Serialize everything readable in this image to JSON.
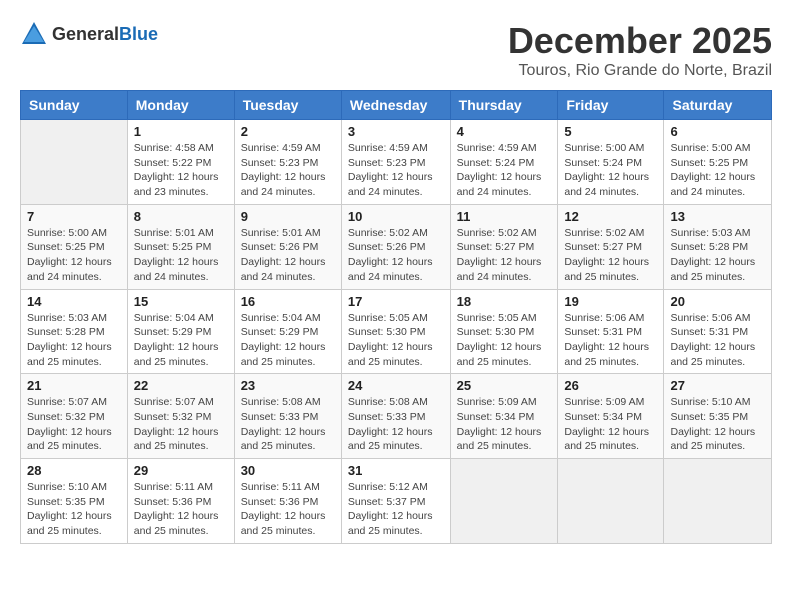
{
  "logo": {
    "general": "General",
    "blue": "Blue"
  },
  "title": "December 2025",
  "subtitle": "Touros, Rio Grande do Norte, Brazil",
  "days_header": [
    "Sunday",
    "Monday",
    "Tuesday",
    "Wednesday",
    "Thursday",
    "Friday",
    "Saturday"
  ],
  "weeks": [
    [
      {
        "day": "",
        "info": ""
      },
      {
        "day": "1",
        "info": "Sunrise: 4:58 AM\nSunset: 5:22 PM\nDaylight: 12 hours\nand 23 minutes."
      },
      {
        "day": "2",
        "info": "Sunrise: 4:59 AM\nSunset: 5:23 PM\nDaylight: 12 hours\nand 24 minutes."
      },
      {
        "day": "3",
        "info": "Sunrise: 4:59 AM\nSunset: 5:23 PM\nDaylight: 12 hours\nand 24 minutes."
      },
      {
        "day": "4",
        "info": "Sunrise: 4:59 AM\nSunset: 5:24 PM\nDaylight: 12 hours\nand 24 minutes."
      },
      {
        "day": "5",
        "info": "Sunrise: 5:00 AM\nSunset: 5:24 PM\nDaylight: 12 hours\nand 24 minutes."
      },
      {
        "day": "6",
        "info": "Sunrise: 5:00 AM\nSunset: 5:25 PM\nDaylight: 12 hours\nand 24 minutes."
      }
    ],
    [
      {
        "day": "7",
        "info": "Sunrise: 5:00 AM\nSunset: 5:25 PM\nDaylight: 12 hours\nand 24 minutes."
      },
      {
        "day": "8",
        "info": "Sunrise: 5:01 AM\nSunset: 5:25 PM\nDaylight: 12 hours\nand 24 minutes."
      },
      {
        "day": "9",
        "info": "Sunrise: 5:01 AM\nSunset: 5:26 PM\nDaylight: 12 hours\nand 24 minutes."
      },
      {
        "day": "10",
        "info": "Sunrise: 5:02 AM\nSunset: 5:26 PM\nDaylight: 12 hours\nand 24 minutes."
      },
      {
        "day": "11",
        "info": "Sunrise: 5:02 AM\nSunset: 5:27 PM\nDaylight: 12 hours\nand 24 minutes."
      },
      {
        "day": "12",
        "info": "Sunrise: 5:02 AM\nSunset: 5:27 PM\nDaylight: 12 hours\nand 25 minutes."
      },
      {
        "day": "13",
        "info": "Sunrise: 5:03 AM\nSunset: 5:28 PM\nDaylight: 12 hours\nand 25 minutes."
      }
    ],
    [
      {
        "day": "14",
        "info": "Sunrise: 5:03 AM\nSunset: 5:28 PM\nDaylight: 12 hours\nand 25 minutes."
      },
      {
        "day": "15",
        "info": "Sunrise: 5:04 AM\nSunset: 5:29 PM\nDaylight: 12 hours\nand 25 minutes."
      },
      {
        "day": "16",
        "info": "Sunrise: 5:04 AM\nSunset: 5:29 PM\nDaylight: 12 hours\nand 25 minutes."
      },
      {
        "day": "17",
        "info": "Sunrise: 5:05 AM\nSunset: 5:30 PM\nDaylight: 12 hours\nand 25 minutes."
      },
      {
        "day": "18",
        "info": "Sunrise: 5:05 AM\nSunset: 5:30 PM\nDaylight: 12 hours\nand 25 minutes."
      },
      {
        "day": "19",
        "info": "Sunrise: 5:06 AM\nSunset: 5:31 PM\nDaylight: 12 hours\nand 25 minutes."
      },
      {
        "day": "20",
        "info": "Sunrise: 5:06 AM\nSunset: 5:31 PM\nDaylight: 12 hours\nand 25 minutes."
      }
    ],
    [
      {
        "day": "21",
        "info": "Sunrise: 5:07 AM\nSunset: 5:32 PM\nDaylight: 12 hours\nand 25 minutes."
      },
      {
        "day": "22",
        "info": "Sunrise: 5:07 AM\nSunset: 5:32 PM\nDaylight: 12 hours\nand 25 minutes."
      },
      {
        "day": "23",
        "info": "Sunrise: 5:08 AM\nSunset: 5:33 PM\nDaylight: 12 hours\nand 25 minutes."
      },
      {
        "day": "24",
        "info": "Sunrise: 5:08 AM\nSunset: 5:33 PM\nDaylight: 12 hours\nand 25 minutes."
      },
      {
        "day": "25",
        "info": "Sunrise: 5:09 AM\nSunset: 5:34 PM\nDaylight: 12 hours\nand 25 minutes."
      },
      {
        "day": "26",
        "info": "Sunrise: 5:09 AM\nSunset: 5:34 PM\nDaylight: 12 hours\nand 25 minutes."
      },
      {
        "day": "27",
        "info": "Sunrise: 5:10 AM\nSunset: 5:35 PM\nDaylight: 12 hours\nand 25 minutes."
      }
    ],
    [
      {
        "day": "28",
        "info": "Sunrise: 5:10 AM\nSunset: 5:35 PM\nDaylight: 12 hours\nand 25 minutes."
      },
      {
        "day": "29",
        "info": "Sunrise: 5:11 AM\nSunset: 5:36 PM\nDaylight: 12 hours\nand 25 minutes."
      },
      {
        "day": "30",
        "info": "Sunrise: 5:11 AM\nSunset: 5:36 PM\nDaylight: 12 hours\nand 25 minutes."
      },
      {
        "day": "31",
        "info": "Sunrise: 5:12 AM\nSunset: 5:37 PM\nDaylight: 12 hours\nand 25 minutes."
      },
      {
        "day": "",
        "info": ""
      },
      {
        "day": "",
        "info": ""
      },
      {
        "day": "",
        "info": ""
      }
    ]
  ]
}
